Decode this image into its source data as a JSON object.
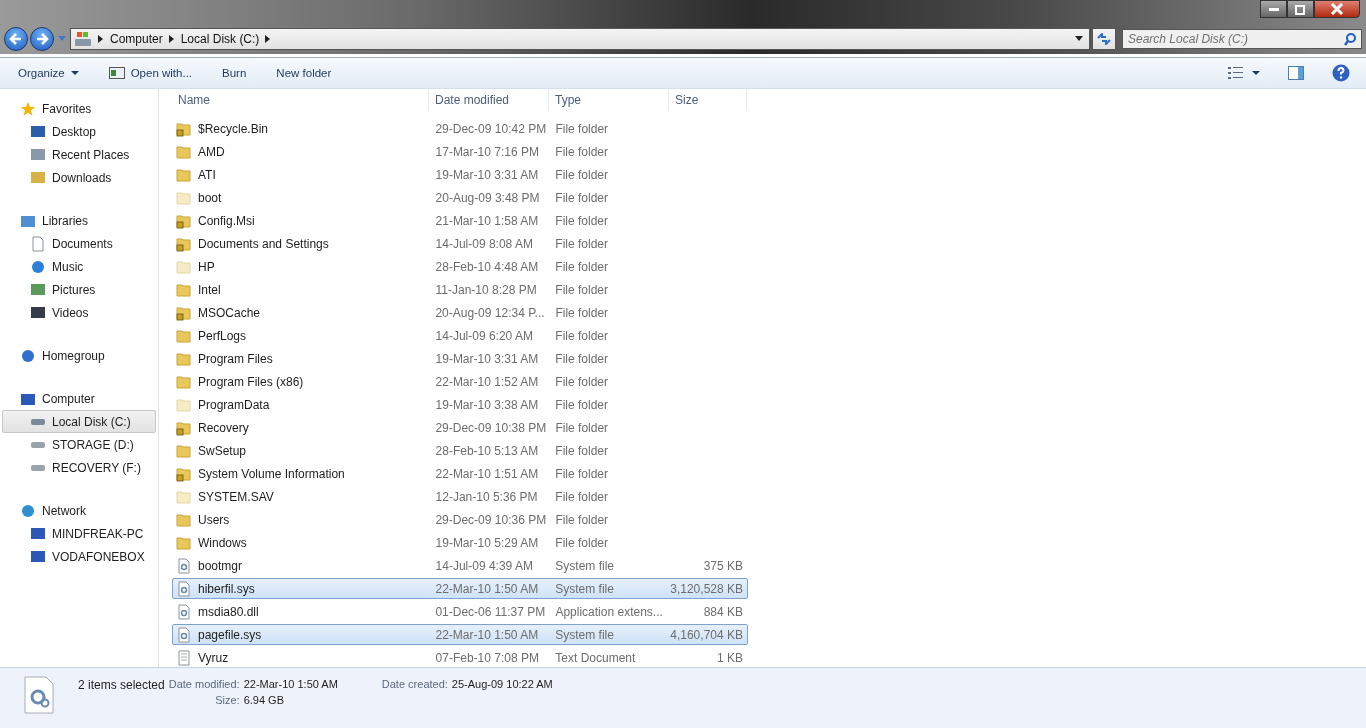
{
  "address": {
    "crumbs": [
      "Computer",
      "Local Disk (C:)"
    ]
  },
  "search": {
    "placeholder": "Search Local Disk (C:)"
  },
  "toolbar": [
    {
      "label": "Organize",
      "kind": "menu"
    },
    {
      "label": "Open with...",
      "kind": "open"
    },
    {
      "label": "Burn",
      "kind": "plain"
    },
    {
      "label": "New folder",
      "kind": "plain"
    }
  ],
  "sidebar": [
    {
      "label": "Favorites",
      "kind": "star",
      "selected": false,
      "children": [
        {
          "label": "Desktop",
          "kind": "desktop",
          "selected": false
        },
        {
          "label": "Recent Places",
          "kind": "recent",
          "selected": false
        },
        {
          "label": "Downloads",
          "kind": "downloads",
          "selected": false
        }
      ]
    },
    {
      "label": "Libraries",
      "kind": "library",
      "selected": false,
      "children": [
        {
          "label": "Documents",
          "kind": "document",
          "selected": false
        },
        {
          "label": "Music",
          "kind": "music",
          "selected": false
        },
        {
          "label": "Pictures",
          "kind": "picture",
          "selected": false
        },
        {
          "label": "Videos",
          "kind": "video",
          "selected": false
        }
      ]
    },
    {
      "label": "Homegroup",
      "kind": "homegroup",
      "selected": false
    },
    {
      "label": "Computer",
      "kind": "computer",
      "selected": false,
      "children": [
        {
          "label": "Local Disk (C:)",
          "kind": "disk",
          "selected": true
        },
        {
          "label": "STORAGE (D:)",
          "kind": "drive",
          "selected": false
        },
        {
          "label": "RECOVERY (F:)",
          "kind": "drive",
          "selected": false
        }
      ]
    },
    {
      "label": "Network",
      "kind": "network",
      "selected": false,
      "children": [
        {
          "label": "MINDFREAK-PC",
          "kind": "computer",
          "selected": false
        },
        {
          "label": "VODAFONEBOX",
          "kind": "computer",
          "selected": false
        }
      ]
    }
  ],
  "columns": [
    "Name",
    "Date modified",
    "Type",
    "Size"
  ],
  "rows": [
    {
      "name": "$Recycle.Bin",
      "date": "29-Dec-09 10:42 PM",
      "type": "File folder",
      "kind": "locked-folder",
      "selected": false
    },
    {
      "name": "AMD",
      "date": "17-Mar-10 7:16 PM",
      "type": "File folder",
      "kind": "folder",
      "selected": false
    },
    {
      "name": "ATI",
      "date": "19-Mar-10 3:31 AM",
      "type": "File folder",
      "kind": "folder",
      "selected": false
    },
    {
      "name": "boot",
      "date": "20-Aug-09 3:48 PM",
      "type": "File folder",
      "kind": "hidden-folder",
      "selected": false
    },
    {
      "name": "Config.Msi",
      "date": "21-Mar-10 1:58 AM",
      "type": "File folder",
      "kind": "locked-folder",
      "selected": false
    },
    {
      "name": "Documents and Settings",
      "date": "14-Jul-09 8:08 AM",
      "type": "File folder",
      "kind": "locked-folder",
      "selected": false
    },
    {
      "name": "HP",
      "date": "28-Feb-10 4:48 AM",
      "type": "File folder",
      "kind": "hidden-folder",
      "selected": false
    },
    {
      "name": "Intel",
      "date": "11-Jan-10 8:28 PM",
      "type": "File folder",
      "kind": "folder",
      "selected": false
    },
    {
      "name": "MSOCache",
      "date": "20-Aug-09 12:34 P...",
      "type": "File folder",
      "kind": "locked-folder",
      "selected": false
    },
    {
      "name": "PerfLogs",
      "date": "14-Jul-09 6:20 AM",
      "type": "File folder",
      "kind": "folder",
      "selected": false
    },
    {
      "name": "Program Files",
      "date": "19-Mar-10 3:31 AM",
      "type": "File folder",
      "kind": "folder",
      "selected": false
    },
    {
      "name": "Program Files (x86)",
      "date": "22-Mar-10 1:52 AM",
      "type": "File folder",
      "kind": "folder",
      "selected": false
    },
    {
      "name": "ProgramData",
      "date": "19-Mar-10 3:38 AM",
      "type": "File folder",
      "kind": "hidden-folder",
      "selected": false
    },
    {
      "name": "Recovery",
      "date": "29-Dec-09 10:38 PM",
      "type": "File folder",
      "kind": "locked-folder",
      "selected": false
    },
    {
      "name": "SwSetup",
      "date": "28-Feb-10 5:13 AM",
      "type": "File folder",
      "kind": "folder",
      "selected": false
    },
    {
      "name": "System Volume Information",
      "date": "22-Mar-10 1:51 AM",
      "type": "File folder",
      "kind": "locked-folder",
      "selected": false
    },
    {
      "name": "SYSTEM.SAV",
      "date": "12-Jan-10 5:36 PM",
      "type": "File folder",
      "kind": "hidden-folder",
      "selected": false
    },
    {
      "name": "Users",
      "date": "29-Dec-09 10:36 PM",
      "type": "File folder",
      "kind": "folder",
      "selected": false
    },
    {
      "name": "Windows",
      "date": "19-Mar-10 5:29 AM",
      "type": "File folder",
      "kind": "folder",
      "selected": false
    },
    {
      "name": "bootmgr",
      "date": "14-Jul-09 4:39 AM",
      "type": "System file",
      "size": "375 KB",
      "kind": "system-file",
      "selected": false
    },
    {
      "name": "hiberfil.sys",
      "date": "22-Mar-10 1:50 AM",
      "type": "System file",
      "size": "3,120,528 KB",
      "kind": "system-file",
      "selected": true
    },
    {
      "name": "msdia80.dll",
      "date": "01-Dec-06 11:37 PM",
      "type": "Application extens...",
      "size": "884 KB",
      "kind": "system-file",
      "selected": false
    },
    {
      "name": "pagefile.sys",
      "date": "22-Mar-10 1:50 AM",
      "type": "System file",
      "size": "4,160,704 KB",
      "kind": "system-file",
      "selected": true
    },
    {
      "name": "Vyruz",
      "date": "07-Feb-10 7:08 PM",
      "type": "Text Document",
      "size": "1 KB",
      "kind": "text-file",
      "selected": false
    }
  ],
  "details": {
    "summary": "2 items selected",
    "fields": [
      {
        "label": "Date modified:",
        "value": "22-Mar-10 1:50 AM"
      },
      {
        "label": "Date created:",
        "value": "25-Aug-09 10:22 AM"
      },
      {
        "label": "Size:",
        "value": "6.94 GB"
      }
    ]
  }
}
